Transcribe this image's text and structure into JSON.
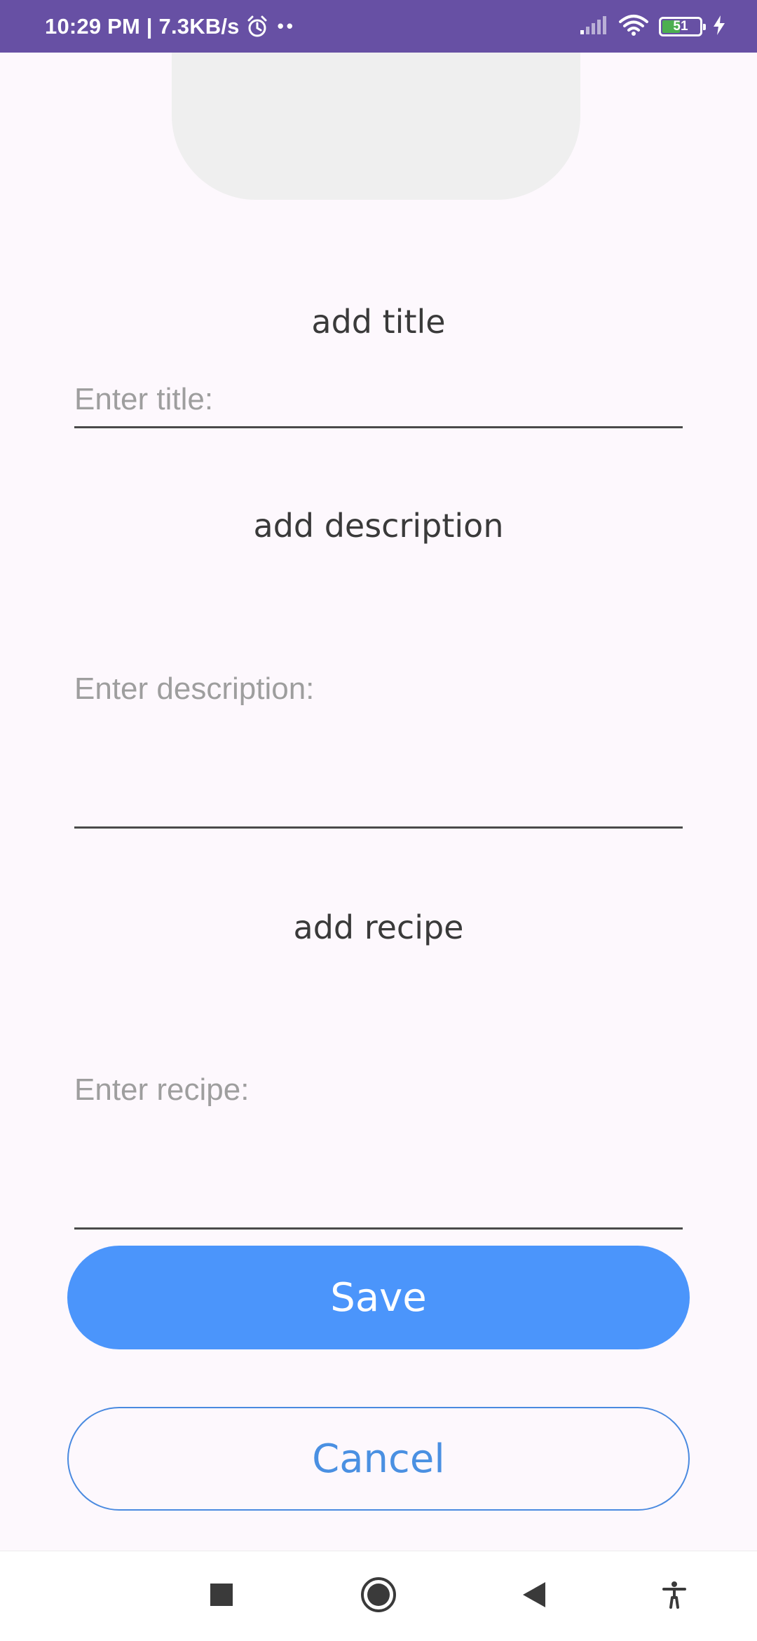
{
  "status_bar": {
    "time_speed": "10:29 PM | 7.3KB/s",
    "dots": "••",
    "battery_level": "51",
    "battery_percent": 51,
    "background_color": "#6750a4",
    "icons": [
      "alarm-icon",
      "signal-icon",
      "wifi-icon",
      "battery-icon",
      "charging-icon"
    ]
  },
  "form": {
    "title_label": "add title",
    "title_placeholder": "Enter title:",
    "description_label": "add description",
    "description_placeholder": "Enter description:",
    "recipe_label": "add recipe",
    "recipe_placeholder": "Enter recipe:"
  },
  "buttons": {
    "save_label": "Save",
    "cancel_label": "Cancel",
    "save_color": "#4b95fb",
    "cancel_color": "#4a90e2"
  },
  "nav_bar": {
    "icons": [
      "recents-icon",
      "home-icon",
      "back-icon",
      "accessibility-icon"
    ]
  }
}
